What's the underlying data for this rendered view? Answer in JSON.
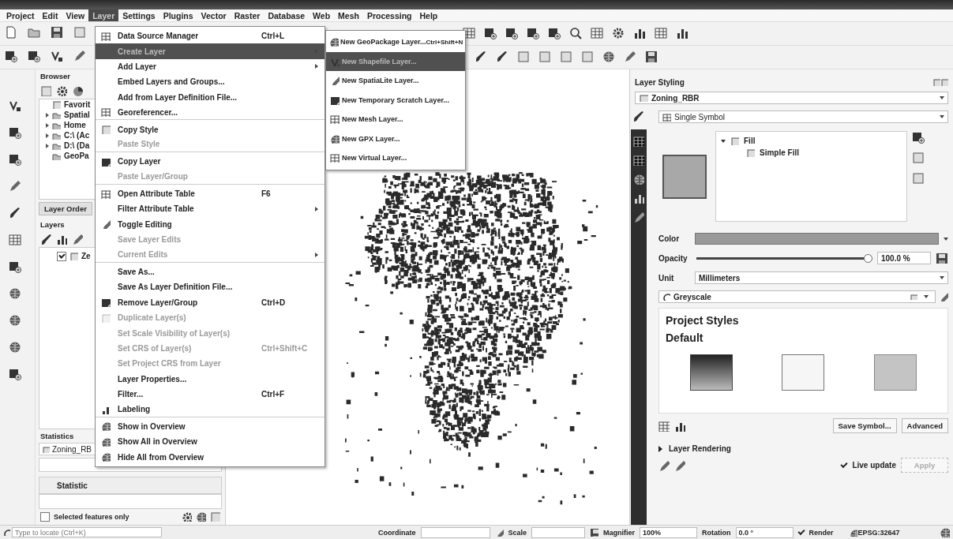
{
  "menubar": [
    {
      "label": "Project",
      "selected": false
    },
    {
      "label": "Edit",
      "selected": false
    },
    {
      "label": "View",
      "selected": false
    },
    {
      "label": "Layer",
      "selected": true
    },
    {
      "label": "Settings",
      "selected": false
    },
    {
      "label": "Plugins",
      "selected": false
    },
    {
      "label": "Vector",
      "selected": false
    },
    {
      "label": "Raster",
      "selected": false
    },
    {
      "label": "Database",
      "selected": false
    },
    {
      "label": "Web",
      "selected": false
    },
    {
      "label": "Mesh",
      "selected": false
    },
    {
      "label": "Processing",
      "selected": false
    },
    {
      "label": "Help",
      "selected": false
    }
  ],
  "layer_menu": [
    {
      "label": "Data Source Manager",
      "shortcut": "Ctrl+L",
      "disabled": false,
      "submenu": false,
      "selected": false,
      "separator_after": false
    },
    {
      "label": "Create Layer",
      "disabled": false,
      "submenu": true,
      "selected": true,
      "separator_after": false
    },
    {
      "label": "Add Layer",
      "disabled": false,
      "submenu": true,
      "selected": false,
      "separator_after": false
    },
    {
      "label": "Embed Layers and Groups...",
      "disabled": false,
      "submenu": false,
      "selected": false,
      "separator_after": false
    },
    {
      "label": "Add from Layer Definition File...",
      "disabled": false,
      "submenu": false,
      "selected": false,
      "separator_after": false
    },
    {
      "label": "Georeferencer...",
      "disabled": false,
      "submenu": false,
      "selected": false,
      "separator_after": true
    },
    {
      "label": "Copy Style",
      "disabled": false,
      "submenu": false,
      "selected": false,
      "separator_after": false
    },
    {
      "label": "Paste Style",
      "disabled": true,
      "submenu": false,
      "selected": false,
      "separator_after": true
    },
    {
      "label": "Copy Layer",
      "disabled": false,
      "submenu": false,
      "selected": false,
      "separator_after": false
    },
    {
      "label": "Paste Layer/Group",
      "disabled": true,
      "submenu": false,
      "selected": false,
      "separator_after": true
    },
    {
      "label": "Open Attribute Table",
      "shortcut": "F6",
      "disabled": false,
      "submenu": false,
      "selected": false,
      "separator_after": false
    },
    {
      "label": "Filter Attribute Table",
      "disabled": false,
      "submenu": true,
      "selected": false,
      "separator_after": false
    },
    {
      "label": "Toggle Editing",
      "disabled": false,
      "submenu": false,
      "selected": false,
      "separator_after": false
    },
    {
      "label": "Save Layer Edits",
      "disabled": true,
      "submenu": false,
      "selected": false,
      "separator_after": false
    },
    {
      "label": "Current Edits",
      "disabled": true,
      "submenu": true,
      "selected": false,
      "separator_after": true
    },
    {
      "label": "Save As...",
      "disabled": false,
      "submenu": false,
      "selected": false,
      "separator_after": false
    },
    {
      "label": "Save As Layer Definition File...",
      "disabled": false,
      "submenu": false,
      "selected": false,
      "separator_after": false
    },
    {
      "label": "Remove Layer/Group",
      "shortcut": "Ctrl+D",
      "disabled": false,
      "submenu": false,
      "selected": false,
      "separator_after": false
    },
    {
      "label": "Duplicate Layer(s)",
      "disabled": true,
      "submenu": false,
      "selected": false,
      "separator_after": false
    },
    {
      "label": "Set Scale Visibility of Layer(s)",
      "disabled": true,
      "submenu": false,
      "selected": false,
      "separator_after": false
    },
    {
      "label": "Set CRS of Layer(s)",
      "shortcut": "Ctrl+Shift+C",
      "disabled": true,
      "submenu": false,
      "selected": false,
      "separator_after": false
    },
    {
      "label": "Set Project CRS from Layer",
      "disabled": true,
      "submenu": false,
      "selected": false,
      "separator_after": false
    },
    {
      "label": "Layer Properties...",
      "disabled": false,
      "submenu": false,
      "selected": false,
      "separator_after": false
    },
    {
      "label": "Filter...",
      "shortcut": "Ctrl+F",
      "disabled": false,
      "submenu": false,
      "selected": false,
      "separator_after": false
    },
    {
      "label": "Labeling",
      "disabled": false,
      "submenu": false,
      "selected": false,
      "separator_after": true
    },
    {
      "label": "Show in Overview",
      "disabled": false,
      "submenu": false,
      "selected": false,
      "separator_after": false
    },
    {
      "label": "Show All in Overview",
      "disabled": false,
      "submenu": false,
      "selected": false,
      "separator_after": false
    },
    {
      "label": "Hide All from Overview",
      "disabled": false,
      "submenu": false,
      "selected": false,
      "separator_after": false
    }
  ],
  "create_layer_submenu": [
    {
      "label": "New GeoPackage Layer...",
      "shortcut": "Ctrl+Shift+N",
      "selected": false
    },
    {
      "label": "New Shapefile Layer...",
      "selected": true
    },
    {
      "label": "New SpatiaLite Layer...",
      "selected": false
    },
    {
      "label": "New Temporary Scratch Layer...",
      "selected": false
    },
    {
      "label": "New Mesh Layer...",
      "selected": false
    },
    {
      "label": "New GPX Layer...",
      "selected": false
    },
    {
      "label": "New Virtual Layer...",
      "selected": false
    }
  ],
  "browser": {
    "title": "Browser",
    "items": [
      {
        "label": "Favorit",
        "expandable": false
      },
      {
        "label": "Spatial",
        "expandable": true
      },
      {
        "label": "Home",
        "expandable": true
      },
      {
        "label": "C:\\ (Ac",
        "expandable": true
      },
      {
        "label": "D:\\ (Da",
        "expandable": true
      },
      {
        "label": "GeoPa",
        "expandable": false
      }
    ]
  },
  "dock_tab": "Layer Order",
  "layers": {
    "title": "Layers",
    "items": [
      {
        "label": "Ze",
        "checked": true
      }
    ]
  },
  "statistics": {
    "title": "Statistics",
    "layer": "Zoning_RB",
    "column_header": "Statistic",
    "selected_only": {
      "label": "Selected features only",
      "checked": false
    }
  },
  "layer_styling": {
    "title": "Layer Styling",
    "layer": "Zoning_RBR",
    "renderer": "Single Symbol",
    "symbol_tree": [
      {
        "label": "Fill",
        "expanded": true,
        "children": [
          {
            "label": "Simple Fill"
          }
        ]
      }
    ],
    "color_label": "Color",
    "opacity_label": "Opacity",
    "opacity": {
      "level": 1.0,
      "value": "100.0 %"
    },
    "unit_label": "Unit",
    "unit": "Millimeters",
    "search": "Greyscale",
    "headings": [
      "Project Styles",
      "Default"
    ],
    "buttons": [
      "Save Symbol...",
      "Advanced"
    ],
    "layer_rendering": {
      "label": "Layer Rendering",
      "expanded": false
    },
    "live_update": {
      "label": "Live update",
      "checked": true
    },
    "apply": {
      "label": "Apply",
      "disabled": true
    }
  },
  "status_bar": {
    "locator_placeholder": "Type to locate (Ctrl+K)",
    "coordinate_label": "Coordinate",
    "scale_label": "Scale",
    "magnifier_label": "Magnifier",
    "magnifier": "100%",
    "rotation_label": "Rotation",
    "rotation": "0.0 °",
    "render": {
      "label": "Render",
      "checked": true
    },
    "crs": "EPSG:32647"
  }
}
